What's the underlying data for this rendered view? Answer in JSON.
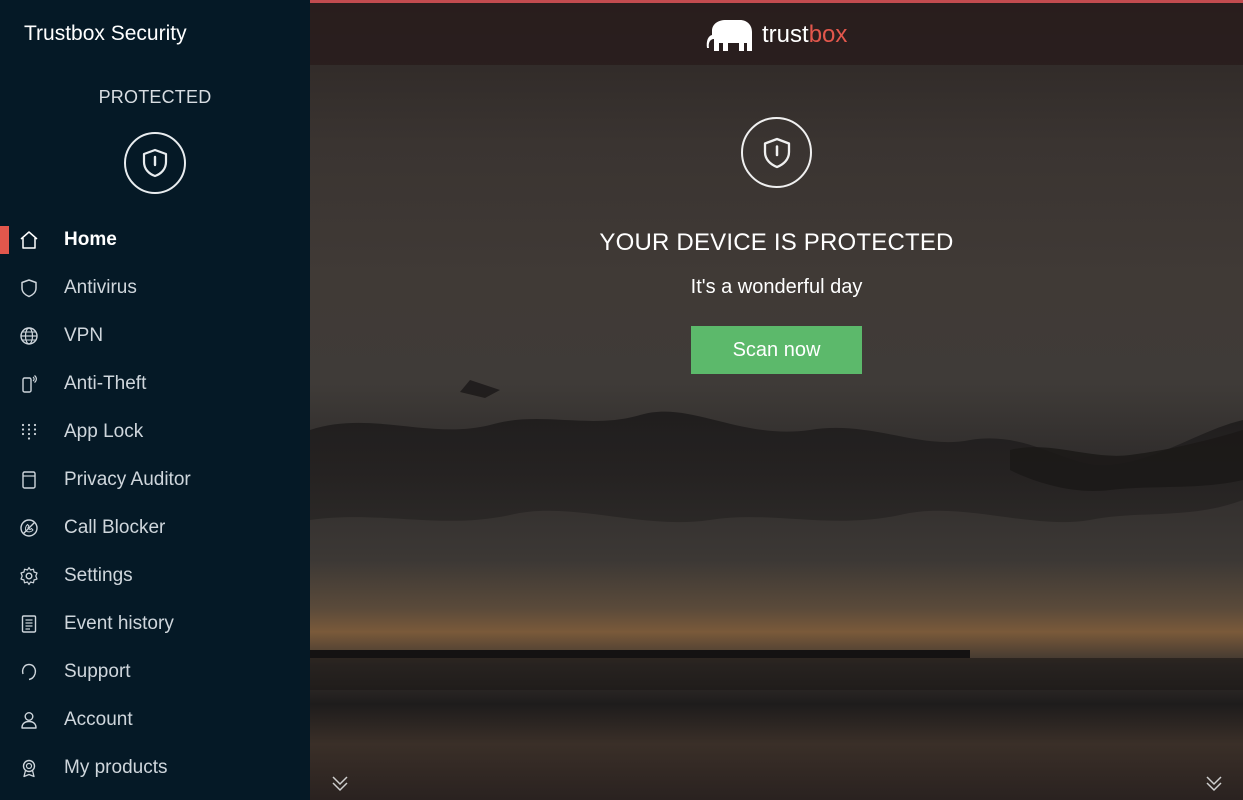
{
  "app": {
    "title": "Trustbox Security"
  },
  "status": {
    "label": "PROTECTED"
  },
  "sidebar": {
    "items": [
      {
        "label": "Home",
        "icon": "home-icon",
        "active": true
      },
      {
        "label": "Antivirus",
        "icon": "shield-icon"
      },
      {
        "label": "VPN",
        "icon": "globe-icon"
      },
      {
        "label": "Anti-Theft",
        "icon": "phone-signal-icon"
      },
      {
        "label": "App Lock",
        "icon": "dot-grid-icon"
      },
      {
        "label": "Privacy Auditor",
        "icon": "document-icon"
      },
      {
        "label": "Call Blocker",
        "icon": "blocked-icon"
      },
      {
        "label": "Settings",
        "icon": "gear-icon"
      },
      {
        "label": "Event history",
        "icon": "list-icon"
      },
      {
        "label": "Support",
        "icon": "headset-icon"
      },
      {
        "label": "Account",
        "icon": "user-icon"
      },
      {
        "label": "My products",
        "icon": "badge-icon"
      }
    ]
  },
  "header": {
    "brand_prefix": "trust",
    "brand_suffix": "box",
    "logo_icon": "elephant-icon"
  },
  "hero": {
    "title": "YOUR DEVICE IS PROTECTED",
    "subtitle": "It's a wonderful day",
    "scan_label": "Scan now"
  },
  "colors": {
    "accent": "#e2574c",
    "sidebar_bg": "#051926",
    "scan_button": "#5cb96b"
  }
}
